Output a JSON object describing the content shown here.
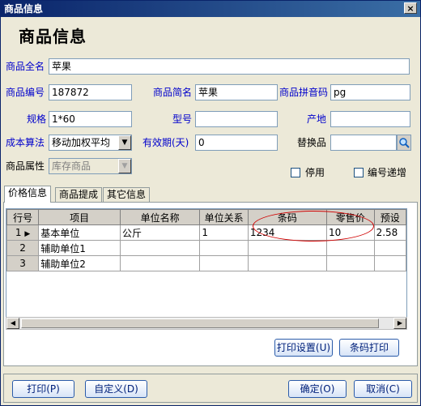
{
  "window": {
    "title": "商品信息",
    "close_glyph": "×"
  },
  "heading": "商品信息",
  "fields": {
    "full_name_label": "商品全名",
    "full_name_value": "苹果",
    "code_label": "商品编号",
    "code_value": "187872",
    "short_name_label": "商品简名",
    "short_name_value": "苹果",
    "pinyin_label": "商品拼音码",
    "pinyin_value": "pg",
    "spec_label": "规格",
    "spec_value": "1*60",
    "model_label": "型号",
    "model_value": "",
    "origin_label": "产地",
    "origin_value": "",
    "cost_method_label": "成本算法",
    "cost_method_value": "移动加权平均",
    "validity_label": "有效期(天)",
    "validity_value": "0",
    "substitute_label": "替换品",
    "substitute_value": "",
    "attribute_label": "商品属性",
    "attribute_value": "库存商品",
    "disabled_label": "停用",
    "disabled_checked": false,
    "auto_increment_label": "编号递增",
    "auto_increment_checked": false
  },
  "tabs": [
    {
      "label": "价格信息",
      "active": true
    },
    {
      "label": "商品提成",
      "active": false
    },
    {
      "label": "其它信息",
      "active": false
    }
  ],
  "grid": {
    "columns": [
      "行号",
      "项目",
      "单位名称",
      "单位关系",
      "条码",
      "零售价",
      "预设"
    ],
    "rows": [
      {
        "num": "1",
        "marker": "▶",
        "item": "基本单位",
        "unit": "公斤",
        "relation": "1",
        "barcode": "1234",
        "retail": "10",
        "preset": "2.58"
      },
      {
        "num": "2",
        "marker": "",
        "item": "辅助单位1",
        "unit": "",
        "relation": "",
        "barcode": "",
        "retail": "",
        "preset": ""
      },
      {
        "num": "3",
        "marker": "",
        "item": "辅助单位2",
        "unit": "",
        "relation": "",
        "barcode": "",
        "retail": "",
        "preset": ""
      }
    ]
  },
  "buttons": {
    "print_settings": "打印设置(U)",
    "barcode_print": "条码打印",
    "print": "打印(P)",
    "customize": "自定义(D)",
    "ok": "确定(O)",
    "cancel": "取消(C)"
  }
}
